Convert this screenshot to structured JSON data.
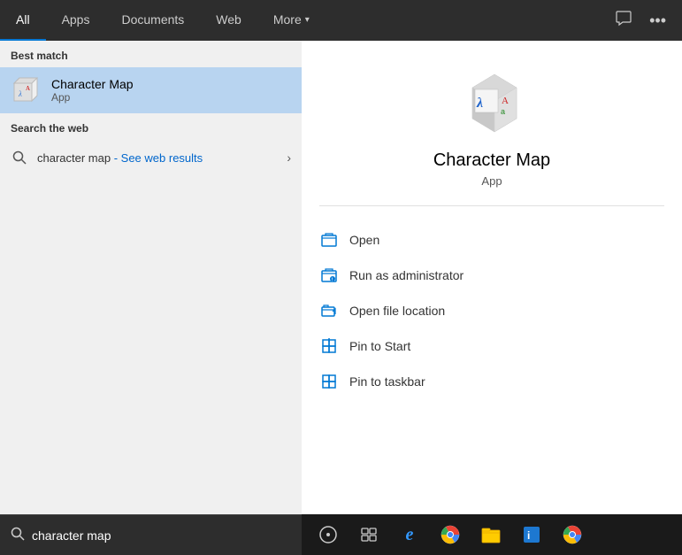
{
  "nav": {
    "tabs": [
      {
        "id": "all",
        "label": "All",
        "active": true
      },
      {
        "id": "apps",
        "label": "Apps",
        "active": false
      },
      {
        "id": "documents",
        "label": "Documents",
        "active": false
      },
      {
        "id": "web",
        "label": "Web",
        "active": false
      },
      {
        "id": "more",
        "label": "More",
        "active": false,
        "hasChevron": true
      }
    ],
    "feedback_icon": "💬",
    "more_icon": "⋯"
  },
  "left_panel": {
    "best_match_label": "Best match",
    "best_match": {
      "title": "Character Map",
      "subtitle": "App"
    },
    "web_section_label": "Search the web",
    "web_item": {
      "query": "character map",
      "see_results": "- See web results"
    }
  },
  "right_panel": {
    "app_name": "Character Map",
    "app_type": "App",
    "actions": [
      {
        "id": "open",
        "label": "Open",
        "icon_type": "folder-open"
      },
      {
        "id": "run-admin",
        "label": "Run as administrator",
        "icon_type": "folder-shield"
      },
      {
        "id": "open-location",
        "label": "Open file location",
        "icon_type": "folder-arrow"
      },
      {
        "id": "pin-start",
        "label": "Pin to Start",
        "icon_type": "pin"
      },
      {
        "id": "pin-taskbar",
        "label": "Pin to taskbar",
        "icon_type": "pin"
      }
    ]
  },
  "search_bar": {
    "query": "character map",
    "placeholder": "character map"
  },
  "taskbar": {
    "buttons": [
      {
        "id": "start",
        "icon": "⊙",
        "label": "Start"
      },
      {
        "id": "task-view",
        "icon": "⧉",
        "label": "Task View"
      },
      {
        "id": "edge",
        "icon": "e",
        "label": "Microsoft Edge"
      },
      {
        "id": "chrome1",
        "icon": "⬤",
        "label": "Chrome"
      },
      {
        "id": "files",
        "icon": "📁",
        "label": "File Explorer"
      },
      {
        "id": "blue-app",
        "icon": "▣",
        "label": "App"
      },
      {
        "id": "chrome2",
        "icon": "⬤",
        "label": "Chrome 2"
      }
    ]
  }
}
